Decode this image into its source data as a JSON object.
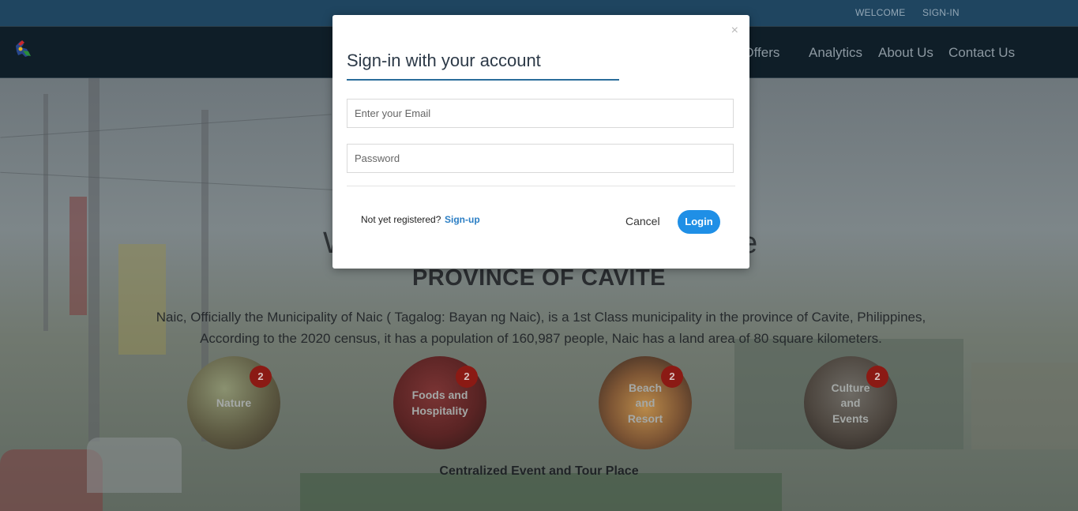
{
  "topbar": {
    "welcome_label": "WELCOME",
    "signin_label": "SIGN-IN"
  },
  "navbar": {
    "items": [
      {
        "label": "r Offers"
      },
      {
        "label": "Analytics"
      },
      {
        "label": "About Us"
      },
      {
        "label": "Contact Us"
      }
    ]
  },
  "hero": {
    "title_left": "W",
    "title_right": "e",
    "subtitle": "PROVINCE OF CAVITE",
    "description_line1": "Naic, Officially the Municipality of Naic ( Tagalog: Bayan ng Naic), is a 1st Class municipality in the province of Cavite, Philippines,",
    "description_line2": "According to the 2020 census, it has a population of 160,987 people, Naic has a land area of 80 square kilometers.",
    "tagline": "Centralized Event and Tour Place"
  },
  "categories": [
    {
      "lines": [
        "Nature"
      ],
      "count": "2"
    },
    {
      "lines": [
        "Foods and",
        "Hospitality"
      ],
      "count": "2"
    },
    {
      "lines": [
        "Beach",
        "and",
        "Resort"
      ],
      "count": "2"
    },
    {
      "lines": [
        "Culture",
        "and",
        "Events"
      ],
      "count": "2"
    }
  ],
  "modal": {
    "close_symbol": "×",
    "title": "Sign-in with your account",
    "email_placeholder": "Enter your Email",
    "password_placeholder": "Password",
    "register_prompt": "Not yet registered?",
    "signup_label": "Sign-up",
    "cancel_label": "Cancel",
    "login_label": "Login"
  },
  "colors": {
    "topbar": "#1f4560",
    "navbar": "#0f1e28",
    "login_button": "#1f8fe6",
    "title_rule": "#2a6d9a",
    "badge": "#8b1a14"
  }
}
